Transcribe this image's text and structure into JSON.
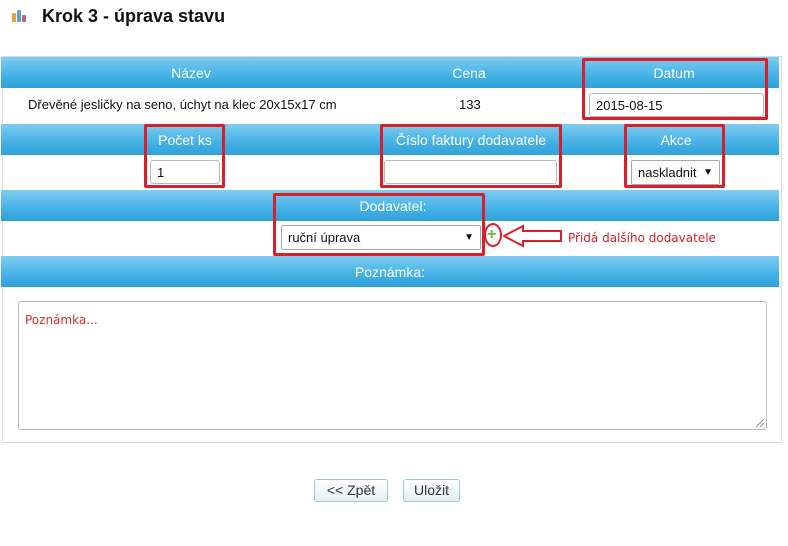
{
  "header": {
    "title": "Krok 3 - úprava stavu",
    "logo": "bar-chart-logo"
  },
  "table": {
    "columns": [
      "Název",
      "Cena",
      "Datum"
    ],
    "row": {
      "name": "Dřevěné jesličky na seno, úchyt na klec 20x15x17 cm",
      "price": "133",
      "date": "2015-08-15"
    },
    "section2_headers": [
      "Počet ks",
      "Číslo faktury dodavatele",
      "Akce"
    ],
    "quantity": "1",
    "invoice_number": "",
    "action_selected": "naskladnit",
    "supplier_header": "Dodavatel:",
    "supplier_selected": "ruční úprava",
    "note_header": "Poznámka:",
    "note_placeholder": "Poznámka..."
  },
  "annotation": {
    "add_supplier_text": "Přidá dalšího dodavatele",
    "color": "#d81f2a"
  },
  "buttons": {
    "back": "<< Zpět",
    "save": "Uložit"
  },
  "colors": {
    "bar_top": "#7fcdf0",
    "bar_bottom": "#2fa1d9",
    "plus": "#6db33f"
  }
}
